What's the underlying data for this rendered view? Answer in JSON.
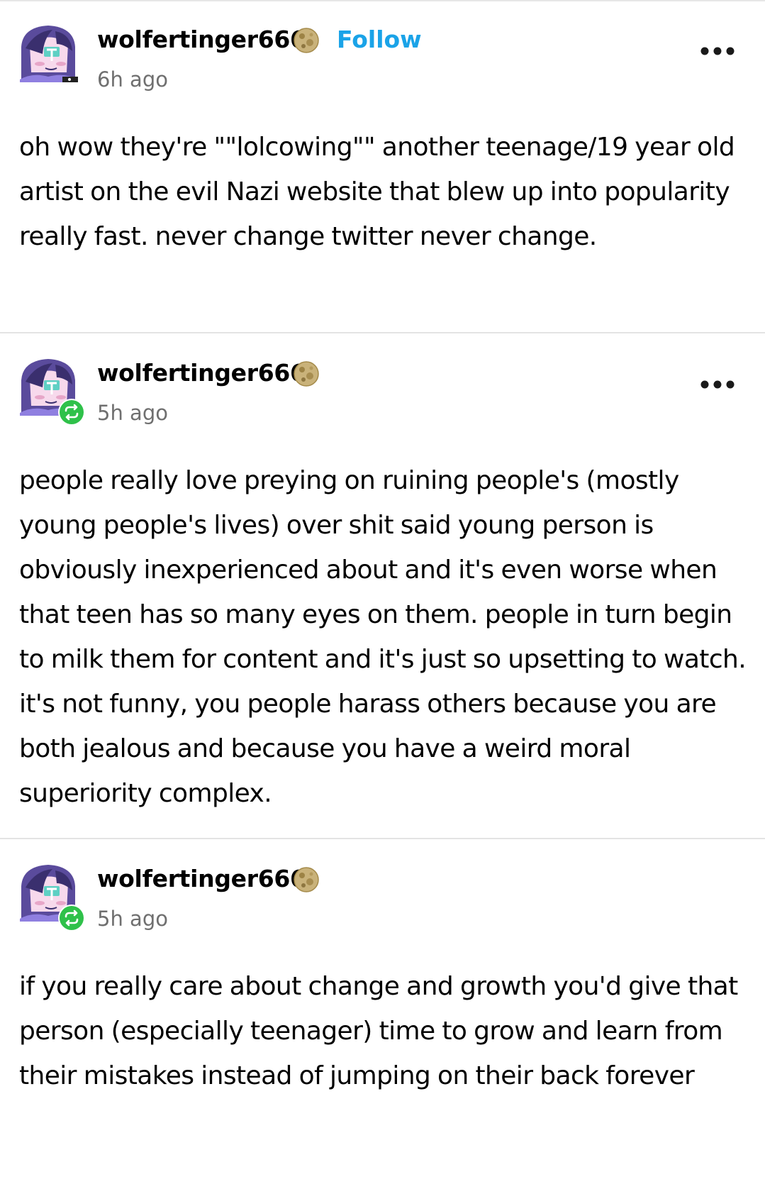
{
  "posts": [
    {
      "username": "wolfertinger666",
      "time": "6h ago",
      "follow_label": "Follow",
      "is_reblog": false,
      "body": "oh wow they're \"\"lolcowing\"\" another teenage/19 year old artist on the evil Nazi website that blew up into popularity really fast. never change twitter never change."
    },
    {
      "username": "wolfertinger666",
      "time": "5h ago",
      "is_reblog": true,
      "body": "people really love preying on ruining people's (mostly young people's lives) over shit said young person is obviously inexperienced about and it's even worse when that teen has so many eyes on them. people in turn begin to milk them for content and it's just so upsetting to watch. it's not funny, you people harass others because you are both jealous and because you have a weird moral superiority complex."
    },
    {
      "username": "wolfertinger666",
      "time": "5h ago",
      "is_reblog": true,
      "body": "if you really care about change and growth you'd give that person (especially teenager) time to grow and learn from their mistakes instead of jumping on their back forever"
    }
  ],
  "icons": {
    "avatar": "purple-haired-character-avatar",
    "badge": "moon-icon",
    "reblog": "reblog-icon",
    "menu": "more-options-icon"
  },
  "colors": {
    "follow": "#1aa3e8",
    "reblog_badge": "#2fc14a",
    "timestamp": "#6f6f6f",
    "divider": "#e3e3e3"
  }
}
